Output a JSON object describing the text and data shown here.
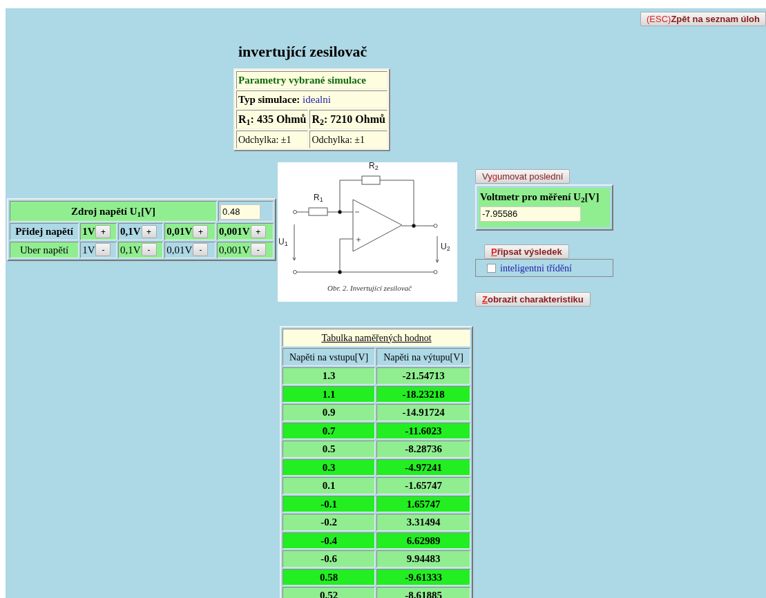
{
  "esc_button": {
    "bold": true,
    "parts": [
      {
        "text": "(ESC)",
        "kind": "hint"
      },
      {
        "text": "Zpět na seznam úloh",
        "kind": "label"
      }
    ]
  },
  "title": "invertující zesilovač",
  "parameters": {
    "heading": "Parametry vybrané simulace",
    "type_label": "Typ simulace:",
    "type_value": "idealni",
    "resistors": [
      {
        "label": "R$_{1}$: 435 Ohmů",
        "tolerance": "Odchylka: ±1"
      },
      {
        "label": "R$_{2}$: 7210 Ohmů",
        "tolerance": "Odchylka: ±1"
      }
    ]
  },
  "source": {
    "heading": "Zdroj napětí U$_{1}$[V]",
    "value": "0.48",
    "rows": [
      {
        "label": "Přidej napětí",
        "bold": true,
        "color": "#add8e6",
        "steps": [
          {
            "label": "1V",
            "color": "#90ee90",
            "button": "+"
          },
          {
            "label": "0,1V",
            "color": "#add8e6",
            "button": "+"
          },
          {
            "label": "0,01V",
            "color": "#90ee90",
            "button": "+"
          },
          {
            "label": "0,001V",
            "color": "#90ee90",
            "button": "+"
          }
        ]
      },
      {
        "label": "Uber napětí",
        "bold": false,
        "color": "#90ee90",
        "steps": [
          {
            "label": "1V",
            "color": "#add8e6",
            "button": "-"
          },
          {
            "label": "0,1V",
            "color": "#90ee90",
            "button": "-"
          },
          {
            "label": "0,01V",
            "color": "#add8e6",
            "button": "-"
          },
          {
            "label": "0,001V",
            "color": "#90ee90",
            "button": "-"
          }
        ]
      }
    ]
  },
  "circuit": {
    "labels": [
      "R$_{1}$",
      "R$_{2}$",
      "U$_{1}$",
      "U$_{2}$"
    ],
    "caption": "Obr. 2. Invertující zesilovač"
  },
  "erase_button": {
    "bold": false,
    "parts": [
      {
        "text": "Vy",
        "kind": "label"
      },
      {
        "text": "g",
        "kind": "accesskey"
      },
      {
        "text": "umovat poslední",
        "kind": "label"
      }
    ]
  },
  "voltmeter": {
    "heading": "Voltmetr pro měření U$_{2}$[V]",
    "value": "-7.95586"
  },
  "record_button": {
    "bold": true,
    "parts": [
      {
        "text": "P",
        "kind": "accesskey"
      },
      {
        "text": "řipsat výsledek",
        "kind": "label"
      }
    ]
  },
  "sorting": {
    "label": "inteligentni třídění",
    "checked": false
  },
  "chart_button": {
    "bold": true,
    "parts": [
      {
        "text": "Z",
        "kind": "accesskey"
      },
      {
        "text": "obrazit charakteristiku",
        "kind": "label"
      }
    ]
  },
  "results": {
    "title": "Tabulka naměřených hodnot",
    "columns": [
      "Napěti na vstupu[V]",
      "Napěti na výtupu[V]"
    ],
    "rows": [
      [
        "1.3",
        "-21.54713"
      ],
      [
        "1.1",
        "-18.23218"
      ],
      [
        "0.9",
        "-14.91724"
      ],
      [
        "0.7",
        "-11.6023"
      ],
      [
        "0.5",
        "-8.28736"
      ],
      [
        "0.3",
        "-4.97241"
      ],
      [
        "0.1",
        "-1.65747"
      ],
      [
        "-0.1",
        "1.65747"
      ],
      [
        "-0.2",
        "3.31494"
      ],
      [
        "-0.4",
        "6.62989"
      ],
      [
        "-0.6",
        "9.94483"
      ],
      [
        "0.58",
        "-9.61333"
      ],
      [
        "0.52",
        "-8.61885"
      ]
    ]
  }
}
